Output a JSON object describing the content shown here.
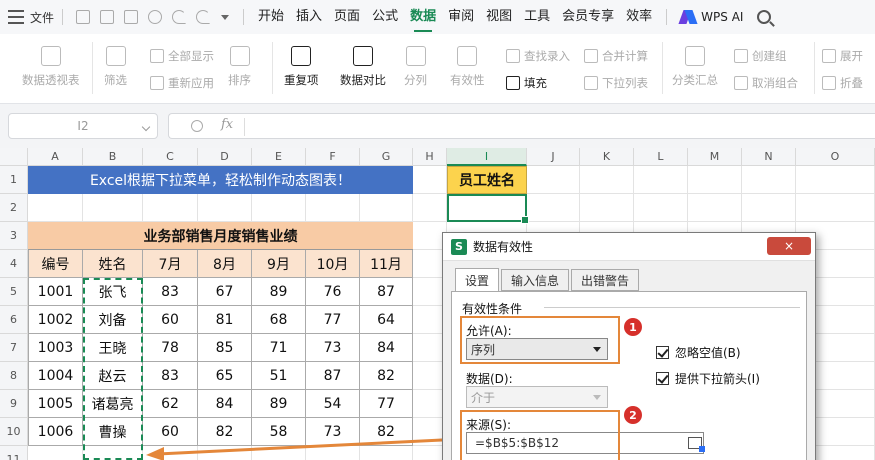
{
  "menubar": {
    "file": "文件",
    "tabs": [
      "开始",
      "插入",
      "页面",
      "公式",
      "数据",
      "审阅",
      "视图",
      "工具",
      "会员专享",
      "效率"
    ],
    "active_tab": 4,
    "ai_label": "WPS AI"
  },
  "ribbon": {
    "pivot": "数据透视表",
    "filter": "筛选",
    "show_all": "全部显示",
    "reapply": "重新应用",
    "sort": "排序",
    "duplicates": "重复项",
    "compare": "数据对比",
    "split": "分列",
    "validity": "有效性",
    "find_entry": "查找录入",
    "fill": "填充",
    "merge_calc": "合并计算",
    "dropdown_list": "下拉列表",
    "subtotal": "分类汇总",
    "create_group": "创建组",
    "ungroup": "取消组合",
    "expand": "展开",
    "collapse": "折叠"
  },
  "formula_bar": {
    "cell_ref": "I2",
    "fx": "fx",
    "value": ""
  },
  "columns": [
    "A",
    "B",
    "C",
    "D",
    "E",
    "F",
    "G",
    "H",
    "I",
    "J",
    "K",
    "L",
    "M",
    "N",
    "O"
  ],
  "selected_column": "I",
  "rows": [
    "1",
    "2",
    "3",
    "4",
    "5",
    "6",
    "7",
    "8",
    "9",
    "10",
    "11"
  ],
  "sheet": {
    "banner": "Excel根据下拉菜单，轻松制作动态图表！",
    "employee_header": "员工姓名",
    "employee_value": "",
    "sales_title": "业务部销售月度销售业绩",
    "table_headers": [
      "编号",
      "姓名",
      "7月",
      "8月",
      "9月",
      "10月",
      "11月"
    ],
    "table_rows": [
      [
        "1001",
        "张飞",
        "83",
        "67",
        "89",
        "76",
        "87"
      ],
      [
        "1002",
        "刘备",
        "60",
        "81",
        "68",
        "77",
        "64"
      ],
      [
        "1003",
        "王晓",
        "78",
        "85",
        "71",
        "73",
        "84"
      ],
      [
        "1004",
        "赵云",
        "83",
        "65",
        "51",
        "87",
        "82"
      ],
      [
        "1005",
        "诸葛亮",
        "62",
        "84",
        "89",
        "54",
        "77"
      ],
      [
        "1006",
        "曹操",
        "60",
        "82",
        "58",
        "73",
        "82"
      ]
    ]
  },
  "dialog": {
    "title": "数据有效性",
    "close": "×",
    "tabs": [
      "设置",
      "输入信息",
      "出错警告"
    ],
    "active_tab": 0,
    "group_title": "有效性条件",
    "allow_label": "允许(A):",
    "allow_value": "序列",
    "data_label": "数据(D):",
    "data_value": "介于",
    "ignore_blank": "忽略空值(B)",
    "dropdown_arrow": "提供下拉箭头(I)",
    "source_label": "来源(S):",
    "source_value": "=$B$5:$B$12",
    "badge1": "1",
    "badge2": "2"
  },
  "colors": {
    "accent": "#1a8a55",
    "banner": "#4472c4",
    "employee_header": "#fcd34d",
    "sales_title": "#f8cba5",
    "highlight": "#e4873a",
    "badge": "#d6302b"
  }
}
